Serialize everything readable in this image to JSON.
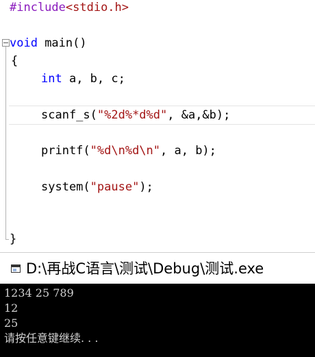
{
  "editor": {
    "line1": {
      "directive": "#include",
      "header": "<stdio.h>"
    },
    "line2": {
      "type": "void",
      "rest": " main()"
    },
    "line3": {
      "text": "{"
    },
    "line4": {
      "type": "int",
      "rest": " a, b, c;"
    },
    "line5": {
      "fn": "scanf_s(",
      "str": "\"%2d%*d%d\"",
      "rest": ", &a,&b);"
    },
    "line6": {
      "fn": "printf(",
      "str": "\"%d\\n%d\\n\"",
      "rest": ", a, b);"
    },
    "line7": {
      "fn": "system(",
      "str": "\"pause\"",
      "rest": ");"
    },
    "line8": {
      "text": "}"
    }
  },
  "console": {
    "title": "D:\\再战C语言\\测试\\Debug\\测试.exe",
    "lines": [
      "1234 25 789",
      "12",
      "25",
      "请按任意键继续. . ."
    ]
  }
}
